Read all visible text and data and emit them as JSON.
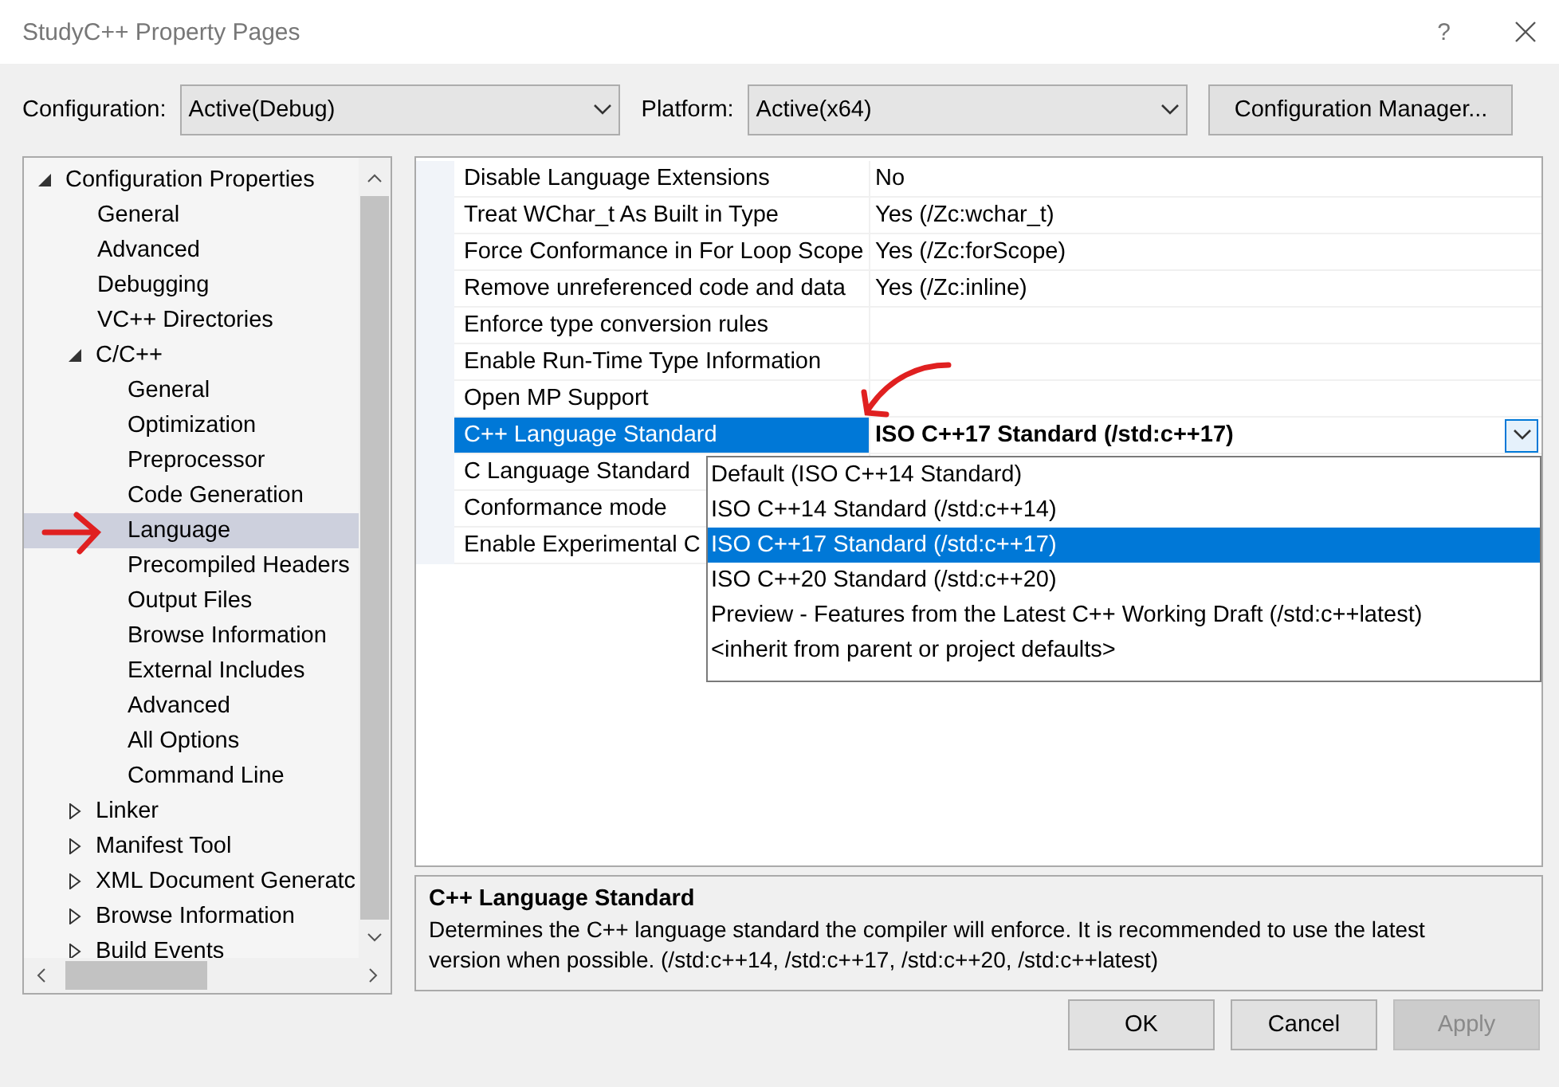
{
  "window": {
    "title": "StudyC++ Property Pages",
    "help": "?"
  },
  "toolbar": {
    "configuration_label": "Configuration:",
    "configuration": "Active(Debug)",
    "platform_label": "Platform:",
    "platform": "Active(x64)",
    "manager_button": "Configuration Manager..."
  },
  "tree": [
    {
      "label": "Configuration Properties",
      "expanded": true,
      "selected": false,
      "children": [
        {
          "label": "General",
          "selected": false
        },
        {
          "label": "Advanced",
          "selected": false
        },
        {
          "label": "Debugging",
          "selected": false
        },
        {
          "label": "VC++ Directories",
          "selected": false
        },
        {
          "label": "C/C++",
          "expanded": true,
          "selected": false,
          "children": [
            {
              "label": "General",
              "selected": false
            },
            {
              "label": "Optimization",
              "selected": false
            },
            {
              "label": "Preprocessor",
              "selected": false
            },
            {
              "label": "Code Generation",
              "selected": false
            },
            {
              "label": "Language",
              "selected": true
            },
            {
              "label": "Precompiled Headers",
              "selected": false
            },
            {
              "label": "Output Files",
              "selected": false
            },
            {
              "label": "Browse Information",
              "selected": false
            },
            {
              "label": "External Includes",
              "selected": false
            },
            {
              "label": "Advanced",
              "selected": false
            },
            {
              "label": "All Options",
              "selected": false
            },
            {
              "label": "Command Line",
              "selected": false
            }
          ]
        },
        {
          "label": "Linker",
          "expanded": false,
          "selected": false
        },
        {
          "label": "Manifest Tool",
          "expanded": false,
          "selected": false
        },
        {
          "label": "XML Document Generatc",
          "expanded": false,
          "selected": false
        },
        {
          "label": "Browse Information",
          "expanded": false,
          "selected": false
        },
        {
          "label": "Build Events",
          "expanded": false,
          "selected": false
        }
      ]
    }
  ],
  "properties": [
    {
      "name": "Disable Language Extensions",
      "value": "No",
      "selected": false
    },
    {
      "name": "Treat WChar_t As Built in Type",
      "value": "Yes (/Zc:wchar_t)",
      "selected": false
    },
    {
      "name": "Force Conformance in For Loop Scope",
      "value": "Yes (/Zc:forScope)",
      "selected": false
    },
    {
      "name": "Remove unreferenced code and data",
      "value": "Yes (/Zc:inline)",
      "selected": false
    },
    {
      "name": "Enforce type conversion rules",
      "selected": false
    },
    {
      "name": "Enable Run-Time Type Information",
      "selected": false
    },
    {
      "name": "Open MP Support",
      "selected": false
    },
    {
      "name": "C++ Language Standard",
      "value": "ISO C++17 Standard (/std:c++17)",
      "selected": true
    },
    {
      "name": "C Language Standard",
      "selected": false
    },
    {
      "name": "Conformance mode",
      "selected": false
    },
    {
      "name": "Enable Experimental C",
      "selected": false
    }
  ],
  "dropdown": {
    "options": [
      {
        "label": "Default (ISO C++14 Standard)",
        "selected": false
      },
      {
        "label": "ISO C++14 Standard (/std:c++14)",
        "selected": false
      },
      {
        "label": "ISO C++17 Standard (/std:c++17)",
        "selected": true
      },
      {
        "label": "ISO C++20 Standard (/std:c++20)",
        "selected": false
      },
      {
        "label": "Preview - Features from the Latest C++ Working Draft (/std:c++latest)",
        "selected": false
      },
      {
        "label": "<inherit from parent or project defaults>",
        "selected": false
      }
    ]
  },
  "description": {
    "title": "C++ Language Standard",
    "text": "Determines the C++ language standard the compiler will enforce. It is recommended to use the latest version when possible. (/std:c++14, /std:c++17, /std:c++20, /std:c++latest)"
  },
  "buttons": [
    {
      "label": "OK",
      "disabled": false
    },
    {
      "label": "Cancel",
      "disabled": false
    },
    {
      "label": "Apply",
      "disabled": true
    }
  ]
}
